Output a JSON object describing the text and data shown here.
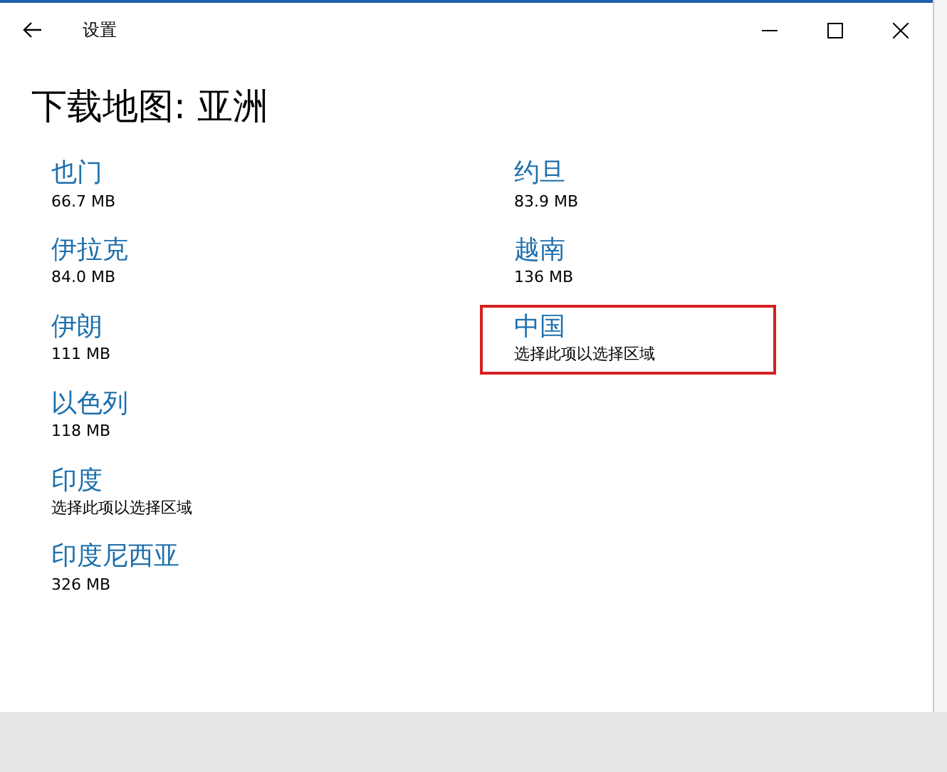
{
  "window": {
    "title": "设置"
  },
  "heading": "下载地图: 亚洲",
  "columns": [
    [
      {
        "name": "也门",
        "detail": "66.7 MB",
        "highlighted": false
      },
      {
        "name": "伊拉克",
        "detail": "84.0 MB",
        "highlighted": false
      },
      {
        "name": "伊朗",
        "detail": "111 MB",
        "highlighted": false
      },
      {
        "name": "以色列",
        "detail": "118 MB",
        "highlighted": false
      },
      {
        "name": "印度",
        "detail": "选择此项以选择区域",
        "highlighted": false
      },
      {
        "name": "印度尼西亚",
        "detail": "326 MB",
        "highlighted": false
      }
    ],
    [
      {
        "name": "约旦",
        "detail": "83.9 MB",
        "highlighted": false
      },
      {
        "name": "越南",
        "detail": "136 MB",
        "highlighted": false
      },
      {
        "name": "中国",
        "detail": "选择此项以选择区域",
        "highlighted": true
      }
    ]
  ]
}
